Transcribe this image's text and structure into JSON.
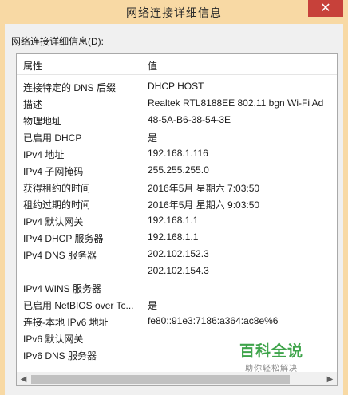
{
  "window": {
    "title": "网络连接详细信息",
    "close_label": "✕"
  },
  "section_label": "网络连接详细信息(D):",
  "table": {
    "columns": [
      "属性",
      "值"
    ],
    "rows": [
      {
        "k": "连接特定的 DNS 后缀",
        "v": "DHCP HOST"
      },
      {
        "k": "描述",
        "v": "Realtek RTL8188EE 802.11 bgn Wi-Fi Ad"
      },
      {
        "k": "物理地址",
        "v": "48-5A-B6-38-54-3E"
      },
      {
        "k": "已启用 DHCP",
        "v": "是"
      },
      {
        "k": "IPv4 地址",
        "v": "192.168.1.116"
      },
      {
        "k": "IPv4 子网掩码",
        "v": "255.255.255.0"
      },
      {
        "k": "获得租约的时间",
        "v": "2016年5月 星期六 7:03:50"
      },
      {
        "k": "租约过期的时间",
        "v": "2016年5月 星期六 9:03:50"
      },
      {
        "k": "IPv4 默认网关",
        "v": "192.168.1.1"
      },
      {
        "k": "IPv4 DHCP 服务器",
        "v": "192.168.1.1"
      },
      {
        "k": "IPv4 DNS 服务器",
        "v": "202.102.152.3"
      },
      {
        "k": "",
        "v": "202.102.154.3"
      },
      {
        "k": "IPv4 WINS 服务器",
        "v": ""
      },
      {
        "k": "已启用 NetBIOS over Tc...",
        "v": "是"
      },
      {
        "k": "连接-本地 IPv6 地址",
        "v": "fe80::91e3:7186:a364:ac8e%6"
      },
      {
        "k": "IPv6 默认网关",
        "v": ""
      },
      {
        "k": "IPv6 DNS 服务器",
        "v": ""
      }
    ]
  },
  "scrollbar": {
    "left_icon": "scroll-left-icon",
    "right_icon": "scroll-right-icon"
  },
  "watermark": {
    "main": "百科全说",
    "sub": "助你轻松解决"
  },
  "colors": {
    "frame": "#f8d9a4",
    "close": "#c7413a",
    "watermark": "#3fa44b"
  }
}
